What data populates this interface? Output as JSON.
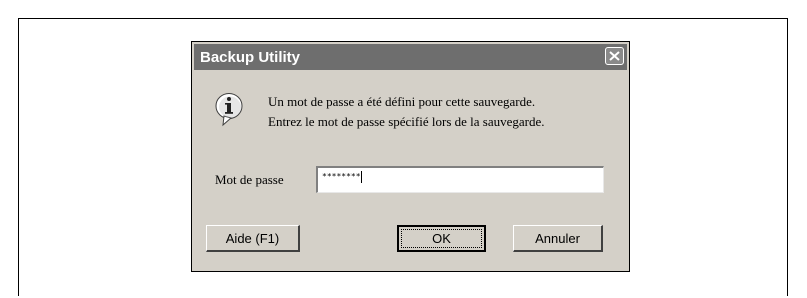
{
  "dialog": {
    "title": "Backup Utility",
    "message_line1": "Un mot de passe a été défini pour cette sauvegarde.",
    "message_line2": "Entrez le mot de passe spécifié lors de la sauvegarde.",
    "icon": "info-icon"
  },
  "password": {
    "label": "Mot de passe",
    "value": "********"
  },
  "buttons": {
    "help": "Aide (F1)",
    "ok": "OK",
    "cancel": "Annuler",
    "close_icon": "close-icon"
  },
  "colors": {
    "dialog_bg": "#d4d0c8",
    "titlebar_bg": "#6e6e6e"
  }
}
